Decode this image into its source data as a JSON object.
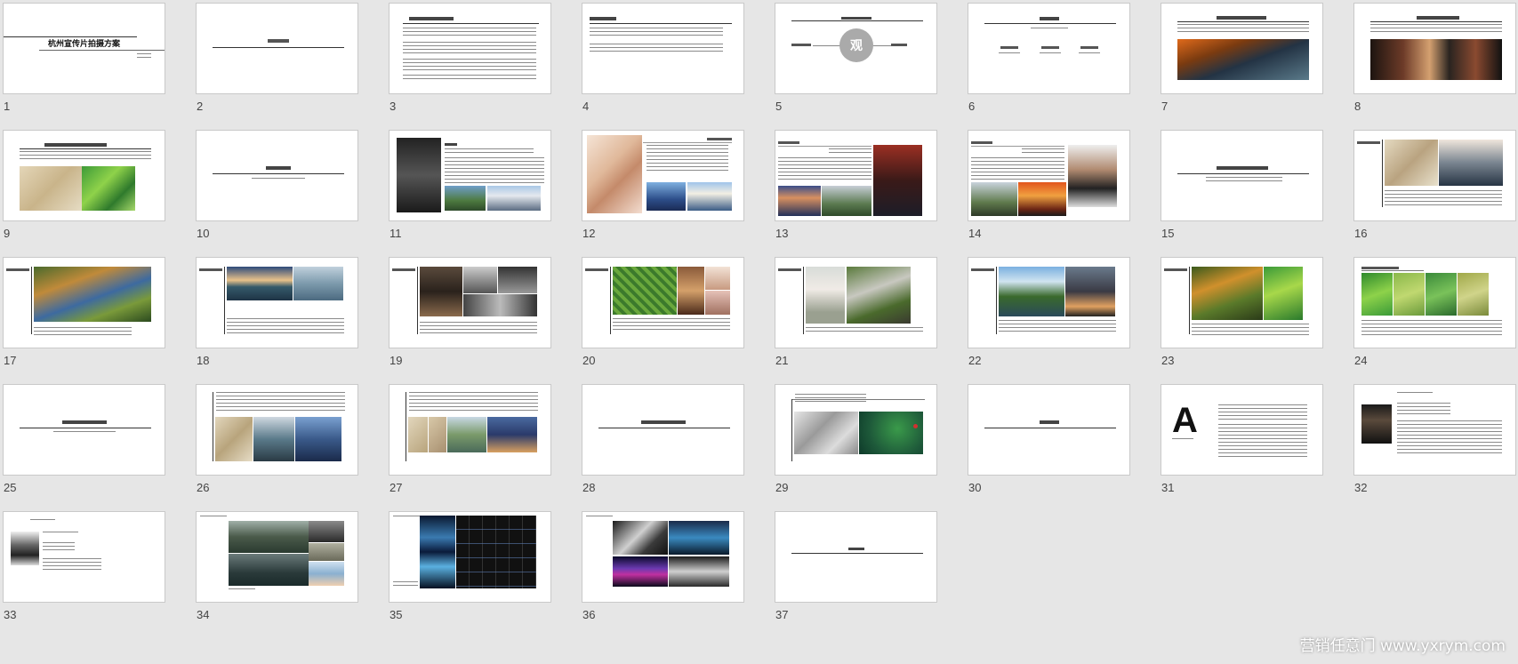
{
  "slides": [
    {
      "number": "1",
      "title": "杭州宣传片拍摄方案"
    },
    {
      "number": "2"
    },
    {
      "number": "3"
    },
    {
      "number": "4"
    },
    {
      "number": "5",
      "circle_char": "观"
    },
    {
      "number": "6"
    },
    {
      "number": "7"
    },
    {
      "number": "8"
    },
    {
      "number": "9"
    },
    {
      "number": "10"
    },
    {
      "number": "11"
    },
    {
      "number": "12"
    },
    {
      "number": "13"
    },
    {
      "number": "14"
    },
    {
      "number": "15"
    },
    {
      "number": "16"
    },
    {
      "number": "17"
    },
    {
      "number": "18"
    },
    {
      "number": "19"
    },
    {
      "number": "20"
    },
    {
      "number": "21"
    },
    {
      "number": "22"
    },
    {
      "number": "23"
    },
    {
      "number": "24"
    },
    {
      "number": "25"
    },
    {
      "number": "26"
    },
    {
      "number": "27"
    },
    {
      "number": "28"
    },
    {
      "number": "29"
    },
    {
      "number": "30"
    },
    {
      "number": "31",
      "big_letter": "A"
    },
    {
      "number": "32"
    },
    {
      "number": "33"
    },
    {
      "number": "34"
    },
    {
      "number": "35"
    },
    {
      "number": "36"
    },
    {
      "number": "37"
    }
  ],
  "watermark": "营销任意门 www.yxrym.com"
}
